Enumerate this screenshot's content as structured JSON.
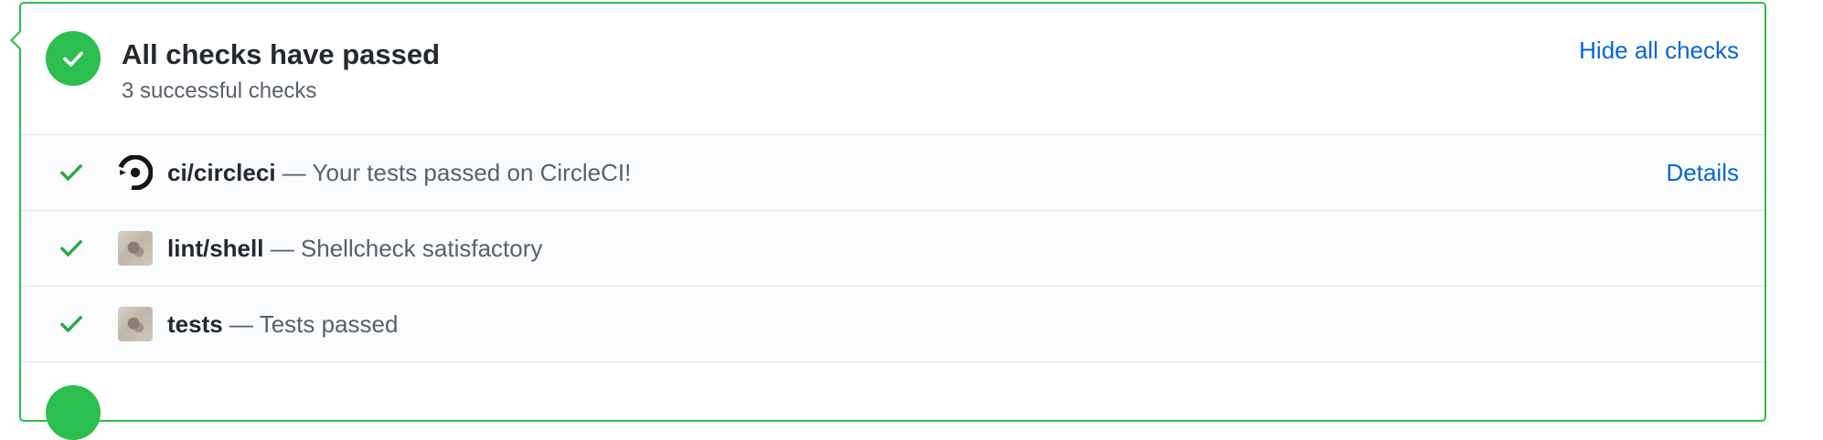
{
  "header": {
    "title": "All checks have passed",
    "subtitle": "3 successful checks",
    "hide_link": "Hide all checks"
  },
  "checks": [
    {
      "name": "ci/circleci",
      "separator": " — ",
      "description": "Your tests passed on CircleCI!",
      "details_label": "Details",
      "avatar_icon": "circleci-logo-icon",
      "status_icon": "check-icon"
    },
    {
      "name": "lint/shell",
      "separator": " — ",
      "description": "Shellcheck satisfactory",
      "avatar_icon": "user-avatar-photo",
      "status_icon": "check-icon"
    },
    {
      "name": "tests",
      "separator": " — ",
      "description": "Tests passed",
      "avatar_icon": "user-avatar-photo",
      "status_icon": "check-icon"
    }
  ],
  "colors": {
    "success": "#2cbe4e",
    "link": "#0366d6",
    "row_background": "#fafbfc",
    "border": "#e1e4e8"
  }
}
